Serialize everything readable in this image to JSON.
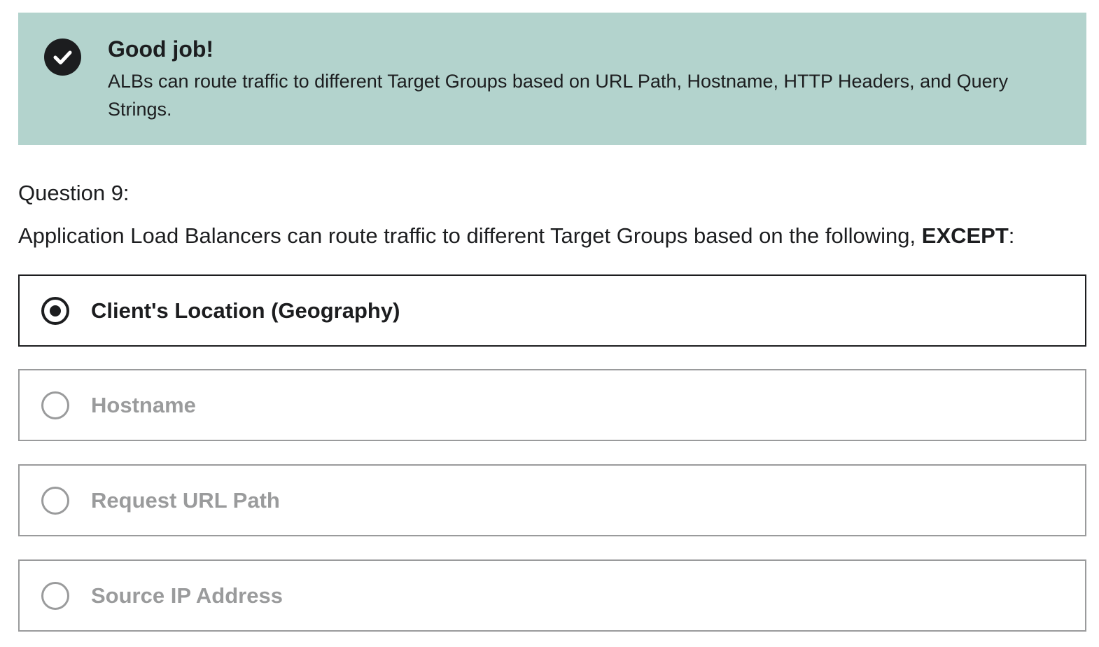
{
  "alert": {
    "icon": "check-circle-icon",
    "title": "Good job!",
    "message": "ALBs can route traffic to different Target Groups based on URL Path, Hostname, HTTP Headers, and Query Strings."
  },
  "question": {
    "number_label": "Question 9:",
    "text_prefix": "Application Load Balancers can route traffic to different Target Groups based on the following,",
    "text_emphasis": "EXCEPT",
    "text_suffix": ":"
  },
  "options": [
    {
      "label": "Client's Location (Geography)",
      "selected": true
    },
    {
      "label": "Hostname",
      "selected": false
    },
    {
      "label": "Request URL Path",
      "selected": false
    },
    {
      "label": "Source IP Address",
      "selected": false
    }
  ],
  "colors": {
    "alert_background": "#b3d3cd",
    "text": "#1c1d1f",
    "muted": "#9a9b9c"
  }
}
